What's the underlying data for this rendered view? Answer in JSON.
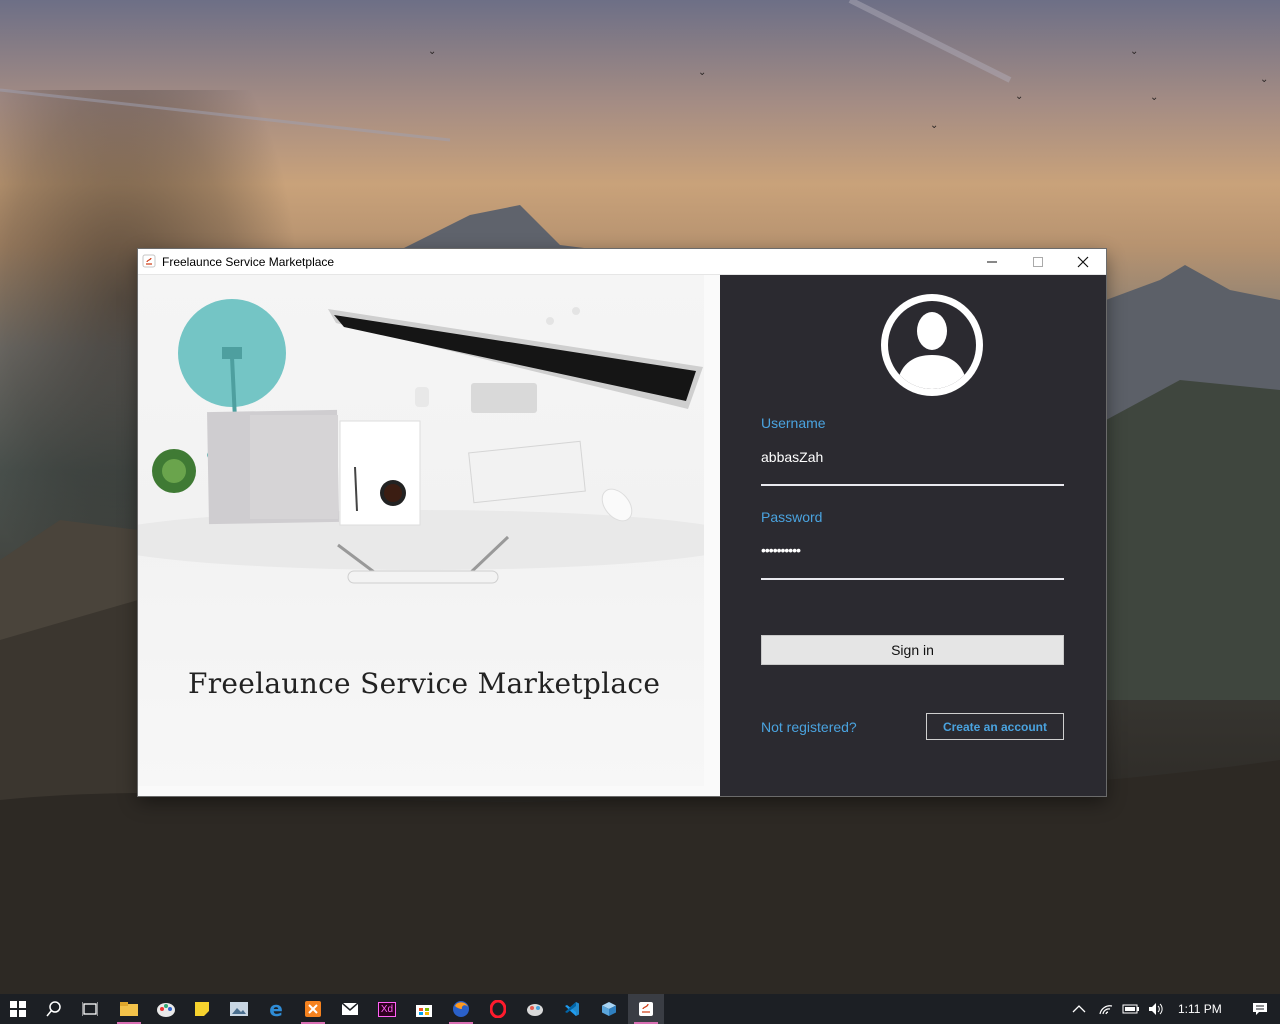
{
  "window": {
    "title": "Freelaunce Service Marketplace",
    "controls": {
      "minimize": "—",
      "maximize": "☐",
      "close": "✕"
    }
  },
  "left_panel": {
    "heading": "Freelaunce Service Marketplace"
  },
  "login": {
    "username_label": "Username",
    "username_value": "abbasZah",
    "password_label": "Password",
    "password_value": "••••••••••",
    "signin_label": "Sign in",
    "not_registered": "Not registered?",
    "create_account": "Create an account"
  },
  "colors": {
    "panel_dark": "#2b2a30",
    "accent_blue": "#4aa3df",
    "taskbar": "#1c1f24"
  },
  "taskbar": {
    "icons": [
      {
        "name": "start-icon",
        "glyph": "⊞"
      },
      {
        "name": "search-icon",
        "glyph": "⌕"
      },
      {
        "name": "task-view-icon",
        "glyph": "▭"
      },
      {
        "name": "file-explorer-icon",
        "glyph": "▬"
      },
      {
        "name": "paint-icon",
        "glyph": "✎"
      },
      {
        "name": "sticky-notes-icon",
        "glyph": "■"
      },
      {
        "name": "photos-icon",
        "glyph": "▣"
      },
      {
        "name": "edge-icon",
        "glyph": "e"
      },
      {
        "name": "xampp-icon",
        "glyph": "⊠"
      },
      {
        "name": "mail-icon",
        "glyph": "✉"
      },
      {
        "name": "adobe-xd-icon",
        "glyph": "Xd"
      },
      {
        "name": "store-icon",
        "glyph": "▤"
      },
      {
        "name": "firefox-icon",
        "glyph": "●"
      },
      {
        "name": "opera-icon",
        "glyph": "O"
      },
      {
        "name": "paint3d-icon",
        "glyph": "◎"
      },
      {
        "name": "vscode-icon",
        "glyph": "⋈"
      },
      {
        "name": "cube-icon",
        "glyph": "◆"
      },
      {
        "name": "java-app-icon",
        "glyph": "☕"
      }
    ],
    "clock": "1:11 PM"
  }
}
